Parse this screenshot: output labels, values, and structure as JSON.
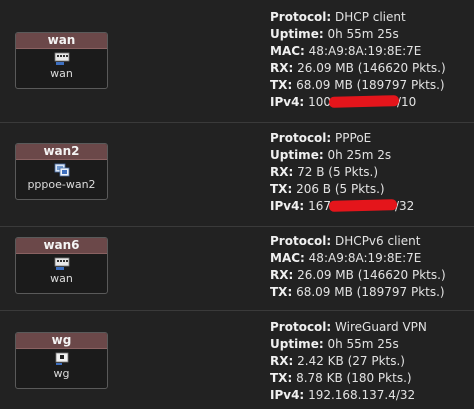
{
  "interfaces": [
    {
      "name": "wan",
      "device": "wan",
      "icon": "ethernet-port-icon",
      "details": [
        {
          "key": "Protocol:",
          "value": "DHCP client"
        },
        {
          "key": "Uptime:",
          "value": "0h 55m 25s"
        },
        {
          "key": "MAC:",
          "value": "48:A9:8A:19:8E:7E"
        },
        {
          "key": "RX:",
          "value": "26.09 MB (146620 Pkts.)"
        },
        {
          "key": "TX:",
          "value": "68.09 MB (189797 Pkts.)"
        },
        {
          "key": "IPv4:",
          "value_prefix": "100",
          "value_suffix": "/10"
        }
      ]
    },
    {
      "name": "wan2",
      "device": "pppoe-wan2",
      "icon": "pppoe-device-icon",
      "details": [
        {
          "key": "Protocol:",
          "value": "PPPoE"
        },
        {
          "key": "Uptime:",
          "value": "0h 25m 2s"
        },
        {
          "key": "RX:",
          "value": "72 B (5 Pkts.)"
        },
        {
          "key": "TX:",
          "value": "206 B (5 Pkts.)"
        },
        {
          "key": "IPv4:",
          "value_prefix": "167",
          "value_suffix": "/32"
        }
      ]
    },
    {
      "name": "wan6",
      "device": "wan",
      "icon": "ethernet-port-icon",
      "details": [
        {
          "key": "Protocol:",
          "value": "DHCPv6 client"
        },
        {
          "key": "MAC:",
          "value": "48:A9:8A:19:8E:7E"
        },
        {
          "key": "RX:",
          "value": "26.09 MB (146620 Pkts.)"
        },
        {
          "key": "TX:",
          "value": "68.09 MB (189797 Pkts.)"
        }
      ]
    },
    {
      "name": "wg",
      "device": "wg",
      "icon": "tunnel-device-icon",
      "details": [
        {
          "key": "Protocol:",
          "value": "WireGuard VPN"
        },
        {
          "key": "Uptime:",
          "value": "0h 55m 25s"
        },
        {
          "key": "RX:",
          "value": "2.42 KB (27 Pkts.)"
        },
        {
          "key": "TX:",
          "value": "8.78 KB (180 Pkts.)"
        },
        {
          "key": "IPv4:",
          "value": "192.168.137.4/32"
        }
      ]
    }
  ],
  "colors": {
    "background": "#1f1f1f",
    "card_header": "#6b4849",
    "redaction": "#e4151b"
  }
}
